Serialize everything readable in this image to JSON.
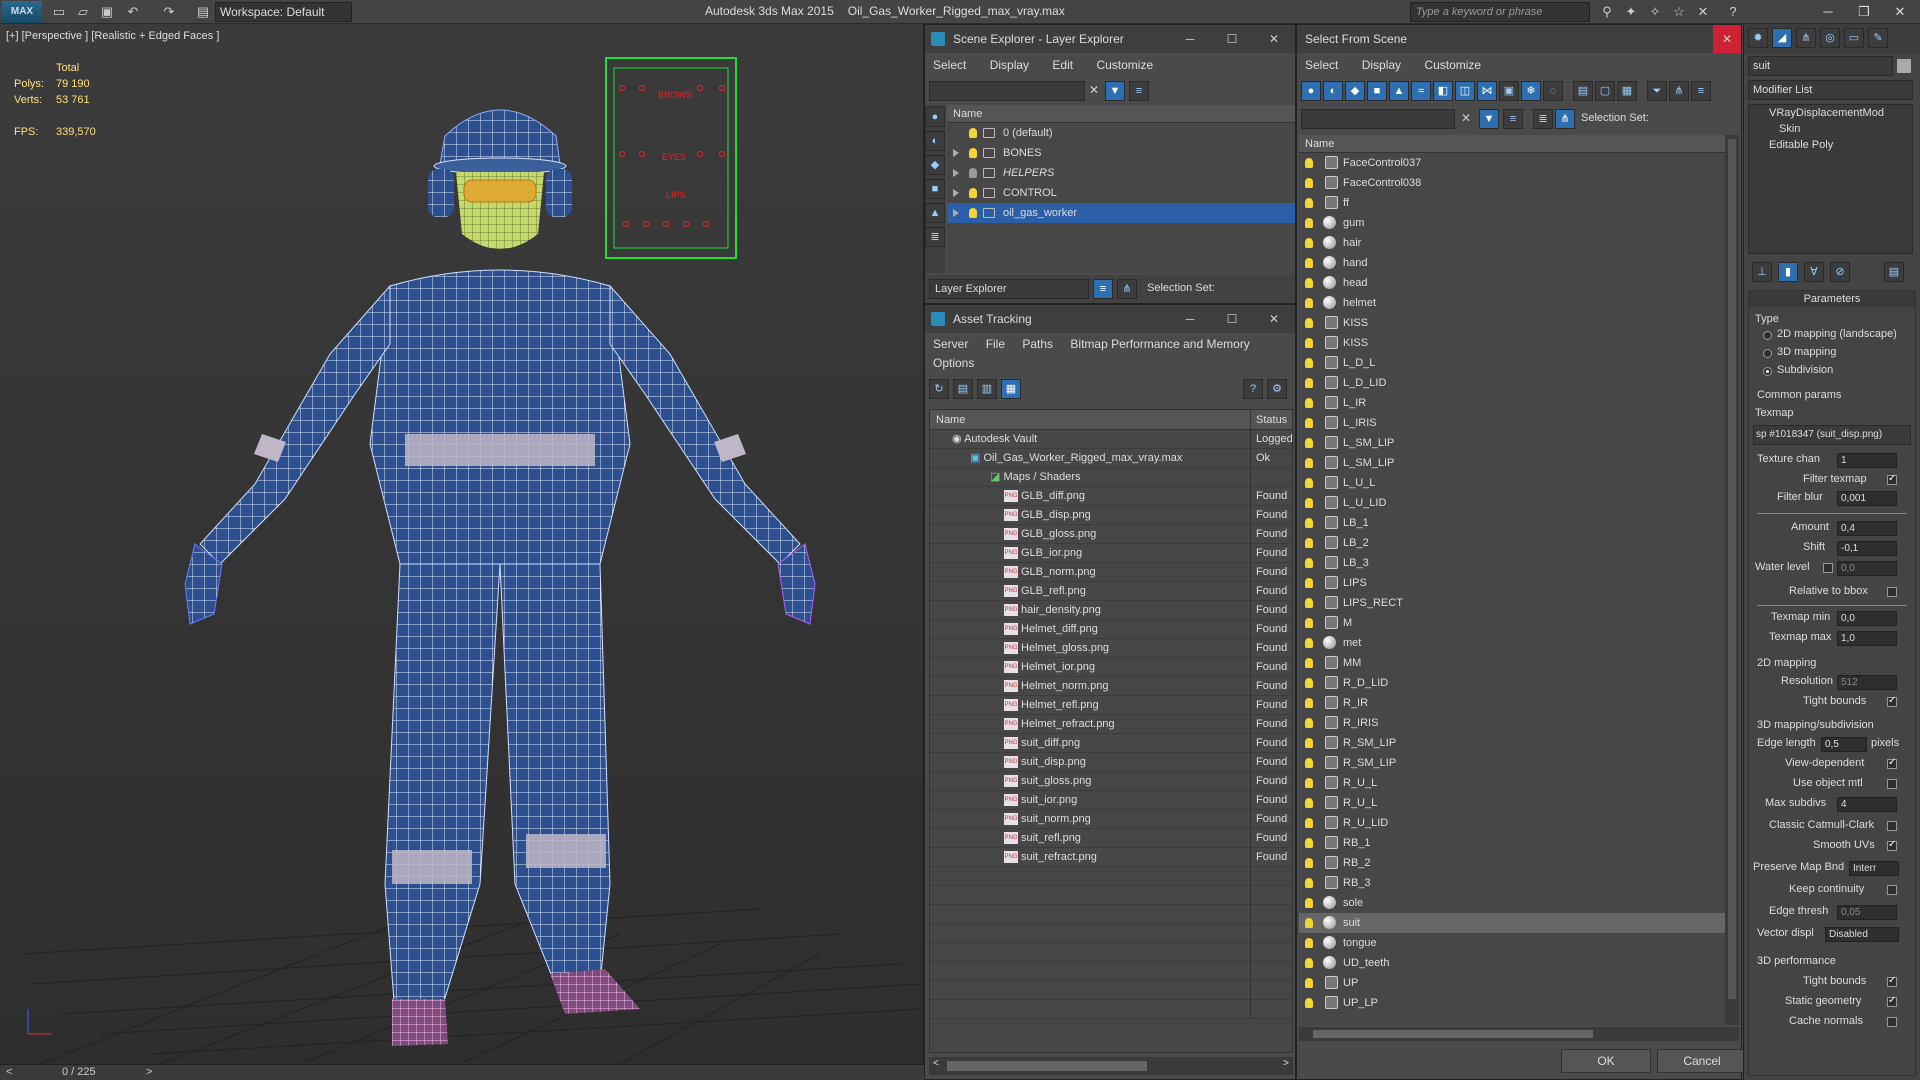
{
  "app": {
    "title_prefix": "Autodesk 3ds Max  2015",
    "file_name": "Oil_Gas_Worker_Rigged_max_vray.max",
    "workspace_label": "Workspace: Default",
    "search_placeholder": "Type a keyword or phrase",
    "logo_text": "MAX"
  },
  "viewport": {
    "label": "[+] [Perspective ] [Realistic + Edged Faces ]",
    "stats": {
      "total_label": "Total",
      "polys_label": "Polys:",
      "polys_value": "79 190",
      "verts_label": "Verts:",
      "verts_value": "53 761",
      "fps_label": "FPS:",
      "fps_value": "339,570"
    },
    "board_labels": [
      "BROWS",
      "EYES",
      "LIPS"
    ],
    "timeline": "0 / 225"
  },
  "scene_explorer": {
    "title": "Scene Explorer - Layer Explorer",
    "menu": [
      "Select",
      "Display",
      "Edit",
      "Customize"
    ],
    "column_name": "Name",
    "layers": [
      {
        "name": "0 (default)",
        "expandable": false,
        "italic": false,
        "selected": false
      },
      {
        "name": "BONES",
        "expandable": true,
        "italic": false,
        "selected": false
      },
      {
        "name": "HELPERS",
        "expandable": true,
        "italic": true,
        "selected": false
      },
      {
        "name": "CONTROL",
        "expandable": true,
        "italic": false,
        "selected": false
      },
      {
        "name": "oil_gas_worker",
        "expandable": true,
        "italic": false,
        "selected": true
      }
    ],
    "footer_dropdown": "Layer Explorer",
    "selection_set_label": "Selection Set:"
  },
  "asset_tracking": {
    "title": "Asset Tracking",
    "menu": [
      "Server",
      "File",
      "Paths",
      "Bitmap Performance and Memory",
      "Options"
    ],
    "columns": [
      "Name",
      "Status"
    ],
    "vault": {
      "name": "Autodesk Vault",
      "status": "Logged"
    },
    "file": {
      "name": "Oil_Gas_Worker_Rigged_max_vray.max",
      "status": "Ok"
    },
    "maps_group": "Maps / Shaders",
    "maps": [
      {
        "name": "GLB_diff.png",
        "status": "Found"
      },
      {
        "name": "GLB_disp.png",
        "status": "Found"
      },
      {
        "name": "GLB_gloss.png",
        "status": "Found"
      },
      {
        "name": "GLB_ior.png",
        "status": "Found"
      },
      {
        "name": "GLB_norm.png",
        "status": "Found"
      },
      {
        "name": "GLB_refl.png",
        "status": "Found"
      },
      {
        "name": "hair_density.png",
        "status": "Found"
      },
      {
        "name": "Helmet_diff.png",
        "status": "Found"
      },
      {
        "name": "Helmet_gloss.png",
        "status": "Found"
      },
      {
        "name": "Helmet_ior.png",
        "status": "Found"
      },
      {
        "name": "Helmet_norm.png",
        "status": "Found"
      },
      {
        "name": "Helmet_refl.png",
        "status": "Found"
      },
      {
        "name": "Helmet_refract.png",
        "status": "Found"
      },
      {
        "name": "suit_diff.png",
        "status": "Found"
      },
      {
        "name": "suit_disp.png",
        "status": "Found"
      },
      {
        "name": "suit_gloss.png",
        "status": "Found"
      },
      {
        "name": "suit_ior.png",
        "status": "Found"
      },
      {
        "name": "suit_norm.png",
        "status": "Found"
      },
      {
        "name": "suit_refl.png",
        "status": "Found"
      },
      {
        "name": "suit_refract.png",
        "status": "Found"
      }
    ]
  },
  "select_from_scene": {
    "title": "Select From Scene",
    "menu": [
      "Select",
      "Display",
      "Customize"
    ],
    "selection_set_label": "Selection Set:",
    "column_name": "Name",
    "items": [
      {
        "name": "FaceControl037",
        "kind": "shape"
      },
      {
        "name": "FaceControl038",
        "kind": "shape"
      },
      {
        "name": "ff",
        "kind": "shape"
      },
      {
        "name": "gum",
        "kind": "mesh"
      },
      {
        "name": "hair",
        "kind": "mesh"
      },
      {
        "name": "hand",
        "kind": "mesh"
      },
      {
        "name": "head",
        "kind": "mesh"
      },
      {
        "name": "helmet",
        "kind": "mesh"
      },
      {
        "name": "KISS",
        "kind": "shape"
      },
      {
        "name": "KISS",
        "kind": "shape"
      },
      {
        "name": "L_D_L",
        "kind": "shape"
      },
      {
        "name": "L_D_LID",
        "kind": "shape"
      },
      {
        "name": "L_IR",
        "kind": "shape"
      },
      {
        "name": "L_IRIS",
        "kind": "shape"
      },
      {
        "name": "L_SM_LIP",
        "kind": "shape"
      },
      {
        "name": "L_SM_LIP",
        "kind": "shape"
      },
      {
        "name": "L_U_L",
        "kind": "shape"
      },
      {
        "name": "L_U_LID",
        "kind": "shape"
      },
      {
        "name": "LB_1",
        "kind": "shape"
      },
      {
        "name": "LB_2",
        "kind": "shape"
      },
      {
        "name": "LB_3",
        "kind": "shape"
      },
      {
        "name": "LIPS",
        "kind": "shape"
      },
      {
        "name": "LIPS_RECT",
        "kind": "shape"
      },
      {
        "name": "M",
        "kind": "shape"
      },
      {
        "name": "met",
        "kind": "mesh"
      },
      {
        "name": "MM",
        "kind": "shape"
      },
      {
        "name": "R_D_LID",
        "kind": "shape"
      },
      {
        "name": "R_IR",
        "kind": "shape"
      },
      {
        "name": "R_IRIS",
        "kind": "shape"
      },
      {
        "name": "R_SM_LIP",
        "kind": "shape"
      },
      {
        "name": "R_SM_LIP",
        "kind": "shape"
      },
      {
        "name": "R_U_L",
        "kind": "shape"
      },
      {
        "name": "R_U_L",
        "kind": "shape"
      },
      {
        "name": "R_U_LID",
        "kind": "shape"
      },
      {
        "name": "RB_1",
        "kind": "shape"
      },
      {
        "name": "RB_2",
        "kind": "shape"
      },
      {
        "name": "RB_3",
        "kind": "shape"
      },
      {
        "name": "sole",
        "kind": "mesh"
      },
      {
        "name": "suit",
        "kind": "mesh",
        "selected": true
      },
      {
        "name": "tongue",
        "kind": "mesh"
      },
      {
        "name": "UD_teeth",
        "kind": "mesh"
      },
      {
        "name": "UP",
        "kind": "shape"
      },
      {
        "name": "UP_LP",
        "kind": "shape"
      }
    ],
    "ok_label": "OK",
    "cancel_label": "Cancel"
  },
  "command_panel": {
    "object_name": "suit",
    "modifier_list_label": "Modifier List",
    "stack": [
      "VRayDisplacementMod",
      "Skin",
      "Editable Poly"
    ],
    "rollout_title": "Parameters",
    "type_label": "Type",
    "type_options": [
      "2D mapping (landscape)",
      "3D mapping",
      "Subdivision"
    ],
    "type_selected": 2,
    "common_params_label": "Common params",
    "texmap_label": "Texmap",
    "texmap_value": "sp #1018347 (suit_disp.png)",
    "texture_chan_label": "Texture chan",
    "texture_chan_value": "1",
    "filter_texmap_label": "Filter texmap",
    "filter_blur_label": "Filter blur",
    "filter_blur_value": "0,001",
    "amount_label": "Amount",
    "amount_value": "0,4",
    "shift_label": "Shift",
    "shift_value": "-0,1",
    "water_level_label": "Water level",
    "water_level_value": "0,0",
    "relative_bbox_label": "Relative to bbox",
    "texmap_min_label": "Texmap min",
    "texmap_min_value": "0,0",
    "texmap_max_label": "Texmap max",
    "texmap_max_value": "1,0",
    "mapping2d_label": "2D mapping",
    "resolution_label": "Resolution",
    "resolution_value": "512",
    "tight_bounds_label": "Tight bounds",
    "mapping3d_label": "3D mapping/subdivision",
    "edge_length_label": "Edge length",
    "edge_length_value": "0,5",
    "pixels_label": "pixels",
    "view_dependent_label": "View-dependent",
    "use_object_mtl_label": "Use object mtl",
    "max_subdivs_label": "Max subdivs",
    "max_subdivs_value": "4",
    "classic_cc_label": "Classic Catmull-Clark",
    "smooth_uvs_label": "Smooth UVs",
    "preserve_map_label": "Preserve Map Bnd",
    "preserve_map_value": "Interr",
    "keep_continuity_label": "Keep continuity",
    "edge_thresh_label": "Edge thresh",
    "edge_thresh_value": "0,05",
    "vector_displ_label": "Vector displ",
    "vector_displ_value": "Disabled",
    "perf3d_label": "3D performance",
    "tight_bounds2_label": "Tight bounds",
    "static_geometry_label": "Static geometry",
    "cache_normals_label": "Cache normals"
  }
}
